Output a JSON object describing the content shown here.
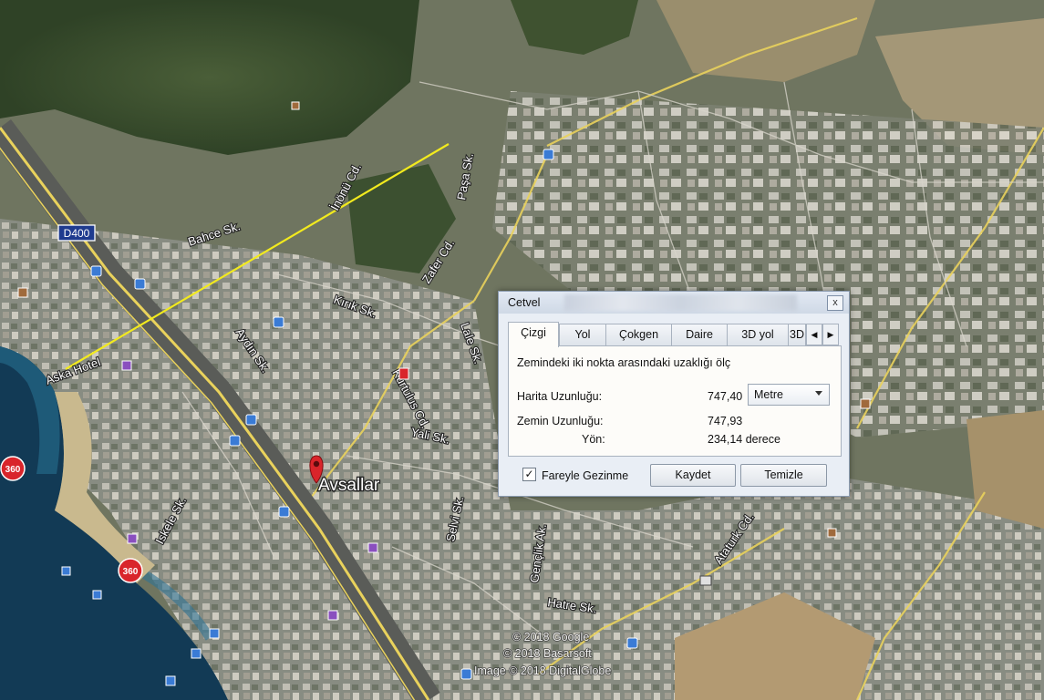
{
  "map": {
    "road_badge": "D400",
    "place_name": "Avsallar",
    "street_labels": [
      "Bahce Sk.",
      "İnönü Cd.",
      "Paşa Sk.",
      "Zafer Cd.",
      "Lale Sk.",
      "Kırık Sk.",
      "Aydın Sk.",
      "Kurtulus Cd.",
      "Yali Sk.",
      "Aska Hotel",
      "Iskele Sk.",
      "Selvi Sk.",
      "Gençlik Ak.",
      "Hatre Sk.",
      "Ataturk Cd."
    ],
    "pano_badge": "360",
    "copyright": [
      "© 2018 Google",
      "© 2018 Basarsoft",
      "Image © 2018 DigitalGlobe"
    ],
    "measure_line_color": "#f2ea1e",
    "colors": {
      "road_yellow": "#e9d25c",
      "sea": "#123a55",
      "badge_red": "#d9252b"
    }
  },
  "dialog": {
    "title": "Cetvel",
    "close": "x",
    "tabs": [
      "Çizgi",
      "Yol",
      "Çokgen",
      "Daire",
      "3D yol",
      "3D"
    ],
    "active_tab": "Çizgi",
    "description": "Zemindeki iki nokta arasındaki uzaklığı ölç",
    "map_length_label": "Harita Uzunluğu:",
    "map_length_value": "747,40",
    "unit": "Metre",
    "ground_length_label": "Zemin Uzunluğu:",
    "ground_length_value": "747,93",
    "heading_label": "Yön:",
    "heading_value": "234,14 derece",
    "mouse_nav_label": "Fareyle Gezinme",
    "mouse_nav_checked": "✓",
    "save_button": "Kaydet",
    "clear_button": "Temizle"
  }
}
